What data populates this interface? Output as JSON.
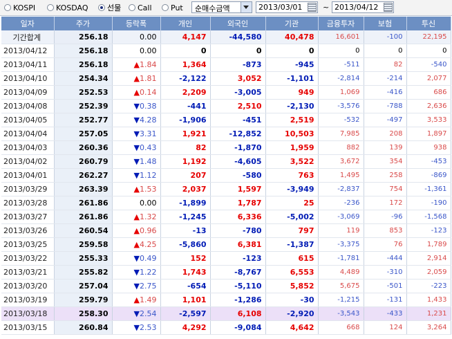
{
  "toolbar": {
    "radios": [
      {
        "label": "KOSPI",
        "selected": false
      },
      {
        "label": "KOSDAQ",
        "selected": false
      },
      {
        "label": "선물",
        "selected": true
      },
      {
        "label": "Call",
        "selected": false
      },
      {
        "label": "Put",
        "selected": false
      }
    ],
    "select_value": "순매수금액",
    "date_from": "2013/03/01",
    "date_to": "2013/04/12",
    "tilde": "~"
  },
  "table": {
    "headers": [
      "일자",
      "주가",
      "등락폭",
      "개인",
      "외국인",
      "기관",
      "금융투자",
      "보험",
      "투신"
    ],
    "rows": [
      {
        "date": "기간합계",
        "price": "256.18",
        "change": "0.00",
        "dir": "",
        "indiv": "4,147",
        "foreign": "-44,580",
        "inst": "40,478",
        "fin": "16,601",
        "ins": "-100",
        "trust": "22,195"
      },
      {
        "date": "2013/04/12",
        "price": "256.18",
        "change": "0.00",
        "dir": "",
        "indiv": "0",
        "foreign": "0",
        "inst": "0",
        "fin": "0",
        "ins": "0",
        "trust": "0"
      },
      {
        "date": "2013/04/11",
        "price": "256.18",
        "change": "1.84",
        "dir": "up",
        "indiv": "1,364",
        "foreign": "-873",
        "inst": "-945",
        "fin": "-511",
        "ins": "82",
        "trust": "-540"
      },
      {
        "date": "2013/04/10",
        "price": "254.34",
        "change": "1.81",
        "dir": "up",
        "indiv": "-2,122",
        "foreign": "3,052",
        "inst": "-1,101",
        "fin": "-2,814",
        "ins": "-214",
        "trust": "2,077"
      },
      {
        "date": "2013/04/09",
        "price": "252.53",
        "change": "0.14",
        "dir": "up",
        "indiv": "2,209",
        "foreign": "-3,005",
        "inst": "949",
        "fin": "1,069",
        "ins": "-416",
        "trust": "686"
      },
      {
        "date": "2013/04/08",
        "price": "252.39",
        "change": "0.38",
        "dir": "down",
        "indiv": "-441",
        "foreign": "2,510",
        "inst": "-2,130",
        "fin": "-3,576",
        "ins": "-788",
        "trust": "2,636"
      },
      {
        "date": "2013/04/05",
        "price": "252.77",
        "change": "4.28",
        "dir": "down",
        "indiv": "-1,906",
        "foreign": "-451",
        "inst": "2,519",
        "fin": "-532",
        "ins": "-497",
        "trust": "3,533"
      },
      {
        "date": "2013/04/04",
        "price": "257.05",
        "change": "3.31",
        "dir": "down",
        "indiv": "1,921",
        "foreign": "-12,852",
        "inst": "10,503",
        "fin": "7,985",
        "ins": "208",
        "trust": "1,897"
      },
      {
        "date": "2013/04/03",
        "price": "260.36",
        "change": "0.43",
        "dir": "down",
        "indiv": "82",
        "foreign": "-1,870",
        "inst": "1,959",
        "fin": "882",
        "ins": "139",
        "trust": "938"
      },
      {
        "date": "2013/04/02",
        "price": "260.79",
        "change": "1.48",
        "dir": "down",
        "indiv": "1,192",
        "foreign": "-4,605",
        "inst": "3,522",
        "fin": "3,672",
        "ins": "354",
        "trust": "-453"
      },
      {
        "date": "2013/04/01",
        "price": "262.27",
        "change": "1.12",
        "dir": "down",
        "indiv": "207",
        "foreign": "-580",
        "inst": "763",
        "fin": "1,495",
        "ins": "258",
        "trust": "-869"
      },
      {
        "date": "2013/03/29",
        "price": "263.39",
        "change": "1.53",
        "dir": "up",
        "indiv": "2,037",
        "foreign": "1,597",
        "inst": "-3,949",
        "fin": "-2,837",
        "ins": "754",
        "trust": "-1,361"
      },
      {
        "date": "2013/03/28",
        "price": "261.86",
        "change": "0.00",
        "dir": "",
        "indiv": "-1,899",
        "foreign": "1,787",
        "inst": "25",
        "fin": "-236",
        "ins": "172",
        "trust": "-190"
      },
      {
        "date": "2013/03/27",
        "price": "261.86",
        "change": "1.32",
        "dir": "up",
        "indiv": "-1,245",
        "foreign": "6,336",
        "inst": "-5,002",
        "fin": "-3,069",
        "ins": "-96",
        "trust": "-1,568"
      },
      {
        "date": "2013/03/26",
        "price": "260.54",
        "change": "0.96",
        "dir": "up",
        "indiv": "-13",
        "foreign": "-780",
        "inst": "797",
        "fin": "119",
        "ins": "853",
        "trust": "-123"
      },
      {
        "date": "2013/03/25",
        "price": "259.58",
        "change": "4.25",
        "dir": "up",
        "indiv": "-5,860",
        "foreign": "6,381",
        "inst": "-1,387",
        "fin": "-3,375",
        "ins": "76",
        "trust": "1,789"
      },
      {
        "date": "2013/03/22",
        "price": "255.33",
        "change": "0.49",
        "dir": "down",
        "indiv": "152",
        "foreign": "-123",
        "inst": "615",
        "fin": "-1,781",
        "ins": "-444",
        "trust": "2,914"
      },
      {
        "date": "2013/03/21",
        "price": "255.82",
        "change": "1.22",
        "dir": "down",
        "indiv": "1,743",
        "foreign": "-8,767",
        "inst": "6,553",
        "fin": "4,489",
        "ins": "-310",
        "trust": "2,059"
      },
      {
        "date": "2013/03/20",
        "price": "257.04",
        "change": "2.75",
        "dir": "down",
        "indiv": "-654",
        "foreign": "-5,110",
        "inst": "5,852",
        "fin": "5,675",
        "ins": "-501",
        "trust": "-223"
      },
      {
        "date": "2013/03/19",
        "price": "259.79",
        "change": "1.49",
        "dir": "up",
        "indiv": "1,101",
        "foreign": "-1,286",
        "inst": "-30",
        "fin": "-1,215",
        "ins": "-131",
        "trust": "1,433"
      },
      {
        "date": "2013/03/18",
        "price": "258.30",
        "change": "2.54",
        "dir": "down",
        "indiv": "-2,597",
        "foreign": "6,108",
        "inst": "-2,920",
        "fin": "-3,543",
        "ins": "-433",
        "trust": "1,231",
        "highlight": true
      },
      {
        "date": "2013/03/15",
        "price": "260.84",
        "change": "2.53",
        "dir": "down",
        "indiv": "4,292",
        "foreign": "-9,084",
        "inst": "4,642",
        "fin": "668",
        "ins": "124",
        "trust": "3,264"
      }
    ]
  },
  "colors": {
    "header_bg": "#6c8fc3",
    "up": "#e60000",
    "down": "#001bb5",
    "highlight_row": "#ece0f8"
  },
  "icons": {
    "up": "triangle-up-icon",
    "down": "triangle-down-icon",
    "calendar": "calendar-icon",
    "dropdown": "chevron-down-icon"
  }
}
